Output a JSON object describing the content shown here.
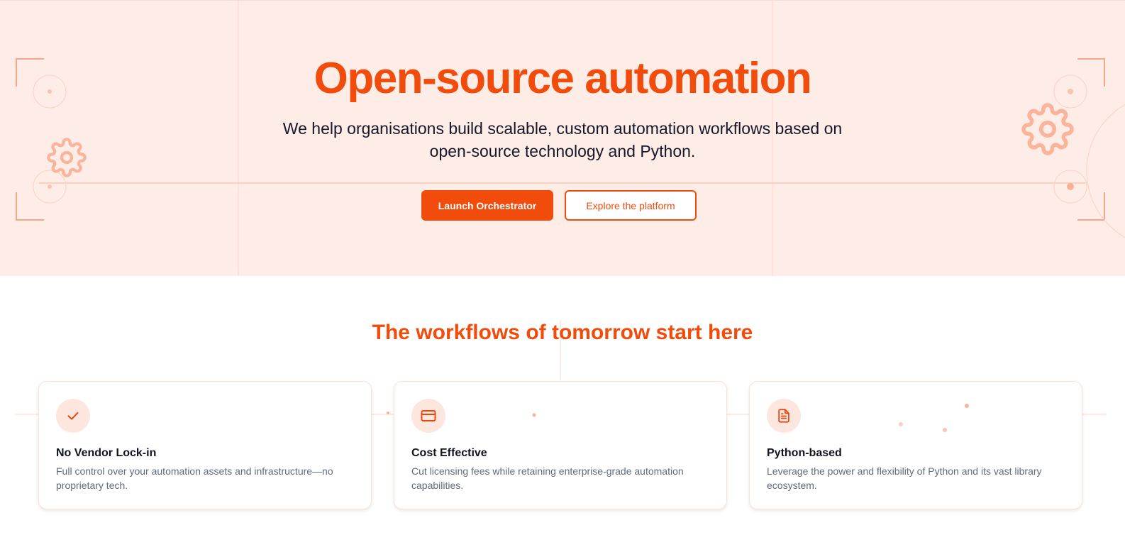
{
  "hero": {
    "title": "Open-source automation",
    "subtitle": "We help organisations build scalable, custom automation workflows based on open-source technology and Python.",
    "primary_button": "Launch Orchestrator",
    "secondary_button": "Explore the platform"
  },
  "features": {
    "title": "The workflows of tomorrow start here",
    "cards": [
      {
        "icon": "check-icon",
        "title": "No Vendor Lock-in",
        "description": "Full control over your automation assets and infrastructure—no proprietary tech."
      },
      {
        "icon": "credit-card-icon",
        "title": "Cost Effective",
        "description": "Cut licensing fees while retaining enterprise-grade automation capabilities."
      },
      {
        "icon": "document-icon",
        "title": "Python-based",
        "description": "Leverage the power and flexibility of Python and its vast library ecosystem."
      }
    ]
  },
  "colors": {
    "brand": "#f24c0c",
    "hero_background": "#feece6",
    "icon_background": "#fde6de",
    "heading_dark": "#111322",
    "body_text": "#5f6a7d"
  }
}
